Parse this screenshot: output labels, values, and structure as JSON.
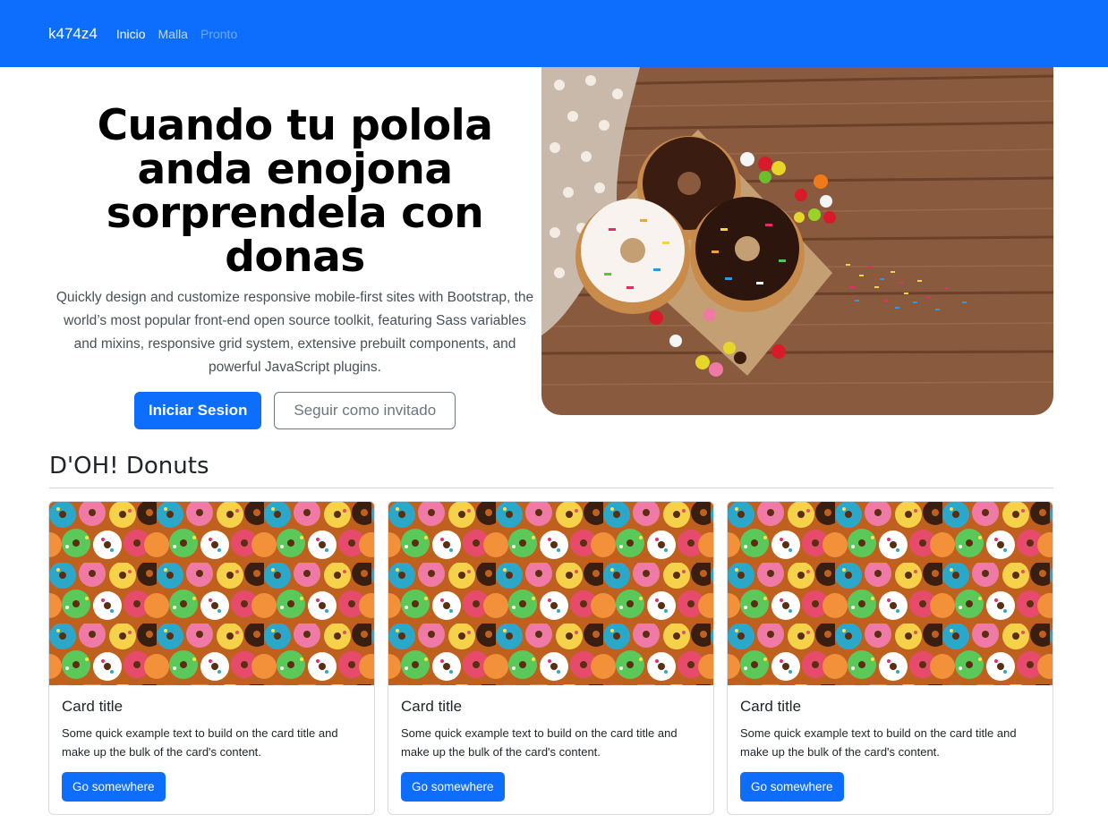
{
  "navbar": {
    "brand": "k474z4",
    "links": [
      {
        "label": "Inicio"
      },
      {
        "label": "Malla"
      },
      {
        "label": "Pronto"
      }
    ]
  },
  "hero": {
    "title": "Cuando tu polola anda enojona sorprendela con donas",
    "lead": "Quickly design and customize responsive mobile-first sites with Bootstrap, the world’s most popular front-end open source toolkit, featuring Sass variables and mixins, responsive grid system, extensive prebuilt components, and powerful JavaScript plugins.",
    "primary_button": "Iniciar Sesion",
    "secondary_button": "Seguir como invitado"
  },
  "section": {
    "title": "D'OH! Donuts"
  },
  "cards": [
    {
      "title": "Card title",
      "text": "Some quick example text to build on the card title and make up the bulk of the card's content.",
      "button": "Go somewhere"
    },
    {
      "title": "Card title",
      "text": "Some quick example text to build on the card title and make up the bulk of the card's content.",
      "button": "Go somewhere"
    },
    {
      "title": "Card title",
      "text": "Some quick example text to build on the card title and make up the bulk of the card's content.",
      "button": "Go somewhere"
    }
  ],
  "colors": {
    "primary": "#0d6efd",
    "secondary": "#6c757d"
  }
}
